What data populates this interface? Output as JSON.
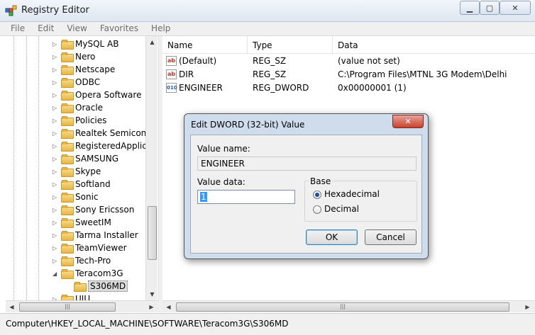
{
  "window": {
    "title": "Registry Editor",
    "min_label": "▁",
    "max_label": "▢",
    "close_label": "✕"
  },
  "menu": [
    "File",
    "Edit",
    "View",
    "Favorites",
    "Help"
  ],
  "tree": {
    "items": [
      {
        "label": "MySQL AB",
        "selected": false
      },
      {
        "label": "Nero",
        "selected": false
      },
      {
        "label": "Netscape",
        "selected": false
      },
      {
        "label": "ODBC",
        "selected": false
      },
      {
        "label": "Opera Software",
        "selected": false
      },
      {
        "label": "Oracle",
        "selected": false
      },
      {
        "label": "Policies",
        "selected": false
      },
      {
        "label": "Realtek Semicond",
        "selected": false
      },
      {
        "label": "RegisteredApplica",
        "selected": false
      },
      {
        "label": "SAMSUNG",
        "selected": false
      },
      {
        "label": "Skype",
        "selected": false
      },
      {
        "label": "Softland",
        "selected": false
      },
      {
        "label": "Sonic",
        "selected": false
      },
      {
        "label": "Sony Ericsson",
        "selected": false
      },
      {
        "label": "SweetIM",
        "selected": false
      },
      {
        "label": "Tarma Installer",
        "selected": false
      },
      {
        "label": "TeamViewer",
        "selected": false
      },
      {
        "label": "Tech-Pro",
        "selected": false
      },
      {
        "label": "Teracom3G",
        "selected": false,
        "expanded": true
      },
      {
        "label": "S306MD",
        "selected": true,
        "child": true
      },
      {
        "label": "UIU",
        "selected": false
      }
    ]
  },
  "list": {
    "columns": [
      "Name",
      "Type",
      "Data"
    ],
    "rows": [
      {
        "icon": "string-value-icon",
        "name": "(Default)",
        "type": "REG_SZ",
        "data": "(value not set)"
      },
      {
        "icon": "string-value-icon",
        "name": "DIR",
        "type": "REG_SZ",
        "data": "C:\\Program Files\\MTNL 3G Modem\\Delhi"
      },
      {
        "icon": "dword-value-icon",
        "name": "ENGINEER",
        "type": "REG_DWORD",
        "data": "0x00000001 (1)"
      }
    ]
  },
  "status": {
    "path": "Computer\\HKEY_LOCAL_MACHINE\\SOFTWARE\\Teracom3G\\S306MD"
  },
  "dialog": {
    "title": "Edit DWORD (32-bit) Value",
    "close_label": "✕",
    "value_name_label": "Value name:",
    "value_name": "ENGINEER",
    "value_data_label": "Value data:",
    "value_data": "1",
    "base_label": "Base",
    "base_options": [
      {
        "label": "Hexadecimal",
        "checked": true
      },
      {
        "label": "Decimal",
        "checked": false
      }
    ],
    "ok_label": "OK",
    "cancel_label": "Cancel"
  },
  "colors": {
    "selection": "#3399ff",
    "dialog_frame": "#cfdcec",
    "close_red": "#c7432f"
  }
}
